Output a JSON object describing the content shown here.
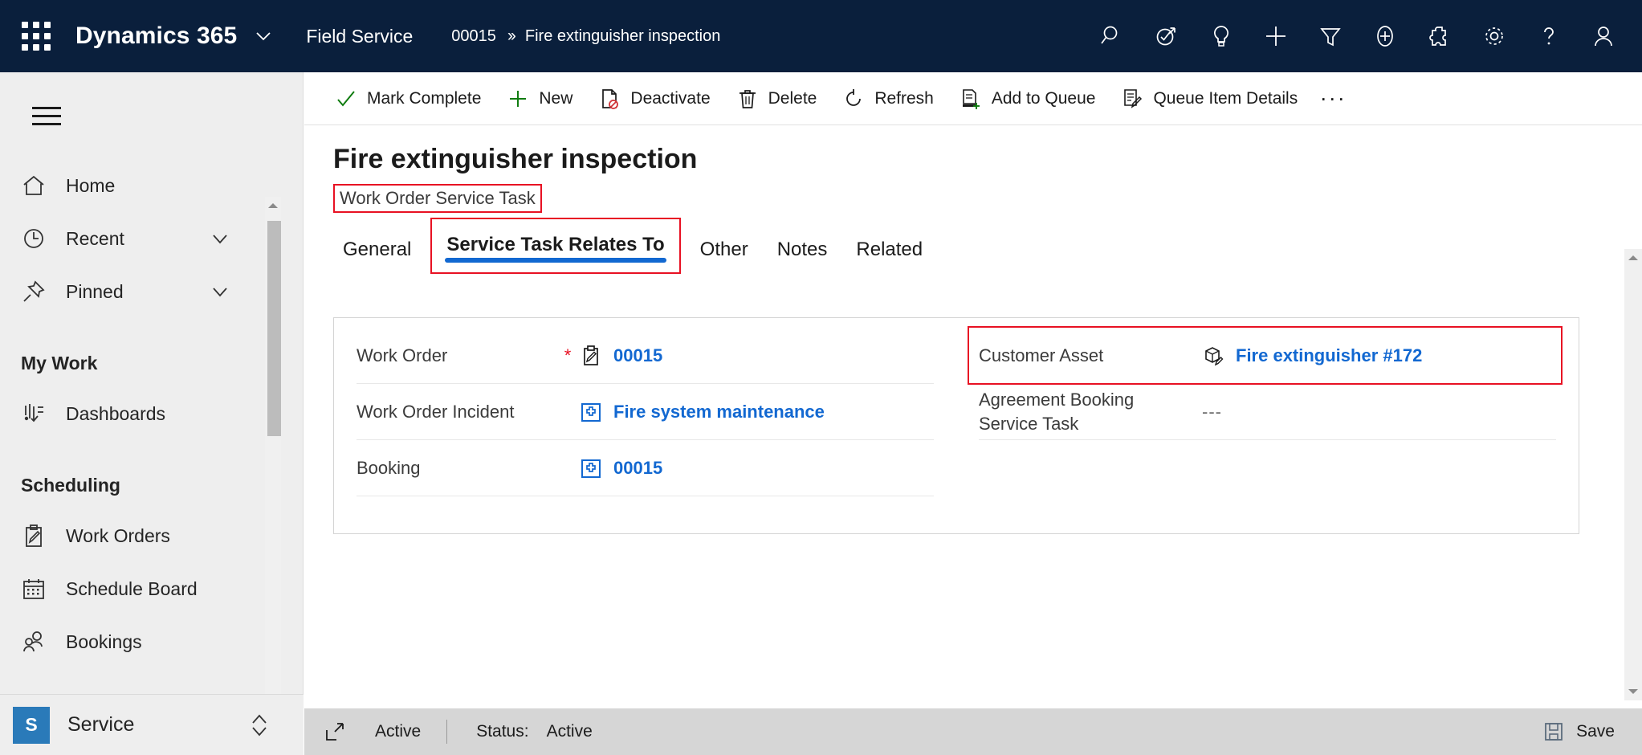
{
  "topbar": {
    "waffle_icon": "app-launcher-icon",
    "brand": "Dynamics 365",
    "brand_chevron_icon": "chevron-down-icon",
    "app_name": "Field Service",
    "breadcrumb": {
      "record_id": "00015",
      "separator": "››",
      "current": "Fire extinguisher inspection"
    },
    "icons": [
      {
        "name": "search-icon",
        "label": "Search"
      },
      {
        "name": "assistant-icon",
        "label": "Assistant"
      },
      {
        "name": "lightbulb-icon",
        "label": "Insights"
      },
      {
        "name": "plus-icon",
        "label": "Quick create"
      },
      {
        "name": "filter-icon",
        "label": "Filter"
      },
      {
        "name": "plus-circle-icon",
        "label": "Add"
      },
      {
        "name": "puzzle-icon",
        "label": "Extensions"
      },
      {
        "name": "gear-icon",
        "label": "Settings"
      },
      {
        "name": "help-icon",
        "label": "Help"
      },
      {
        "name": "user-icon",
        "label": "Account"
      }
    ]
  },
  "sidebar": {
    "hamburger_icon": "hamburger-menu-icon",
    "items": [
      {
        "label": "Home",
        "icon": "home-icon",
        "chevron": false
      },
      {
        "label": "Recent",
        "icon": "clock-icon",
        "chevron": true
      },
      {
        "label": "Pinned",
        "icon": "pin-icon",
        "chevron": true
      }
    ],
    "groups": [
      {
        "title": "My Work",
        "items": [
          {
            "label": "Dashboards",
            "icon": "dashboard-icon"
          }
        ]
      },
      {
        "title": "Scheduling",
        "items": [
          {
            "label": "Work Orders",
            "icon": "clipboard-pencil-icon"
          },
          {
            "label": "Schedule Board",
            "icon": "calendar-icon"
          },
          {
            "label": "Bookings",
            "icon": "people-icon"
          }
        ]
      }
    ],
    "app_switcher": {
      "badge": "S",
      "label": "Service",
      "badge_color": "#2a7ab9",
      "updown_icon": "chevron-up-down-icon"
    }
  },
  "command_bar": {
    "commands": [
      {
        "label": "Mark Complete",
        "icon": "check-icon",
        "icon_color": "#107c10"
      },
      {
        "label": "New",
        "icon": "plus-icon",
        "icon_color": "#107c10"
      },
      {
        "label": "Deactivate",
        "icon": "page-block-icon",
        "icon_color": "#1b1b1b"
      },
      {
        "label": "Delete",
        "icon": "trash-icon",
        "icon_color": "#1b1b1b"
      },
      {
        "label": "Refresh",
        "icon": "refresh-icon",
        "icon_color": "#1b1b1b"
      },
      {
        "label": "Add to Queue",
        "icon": "add-to-queue-icon",
        "icon_color": "#1b1b1b"
      },
      {
        "label": "Queue Item Details",
        "icon": "queue-details-icon",
        "icon_color": "#1b1b1b"
      }
    ],
    "overflow": "···"
  },
  "page": {
    "title": "Fire extinguisher inspection",
    "subtitle": "Work Order Service Task",
    "subtitle_annotated": true,
    "tabs": [
      {
        "label": "General",
        "active": false,
        "annotated": false
      },
      {
        "label": "Service Task Relates To",
        "active": true,
        "annotated": true
      },
      {
        "label": "Other",
        "active": false,
        "annotated": false
      },
      {
        "label": "Notes",
        "active": false,
        "annotated": false
      },
      {
        "label": "Related",
        "active": false,
        "annotated": false
      }
    ],
    "accent_color": "#1268d1",
    "annotation_color": "#e81123"
  },
  "form": {
    "left_column": [
      {
        "label": "Work Order",
        "required": true,
        "icon": "clipboard-pencil-icon",
        "value": "00015",
        "is_link": true,
        "annotated": false
      },
      {
        "label": "Work Order Incident",
        "required": false,
        "icon": "incident-icon",
        "value": "Fire system maintenance",
        "is_link": true,
        "annotated": false
      },
      {
        "label": "Booking",
        "required": false,
        "icon": "incident-icon",
        "value": "00015",
        "is_link": true,
        "annotated": false
      }
    ],
    "right_column": [
      {
        "label": "Customer Asset",
        "required": false,
        "icon": "asset-box-icon",
        "value": "Fire extinguisher #172",
        "is_link": true,
        "annotated": true
      },
      {
        "label": "Agreement Booking Service Task",
        "required": false,
        "icon": "",
        "value": "---",
        "is_link": false,
        "annotated": false
      }
    ]
  },
  "footer": {
    "expand_icon": "expand-icon",
    "state": "Active",
    "status_label": "Status:",
    "status_value": "Active",
    "save_icon": "save-icon",
    "save_label": "Save"
  }
}
